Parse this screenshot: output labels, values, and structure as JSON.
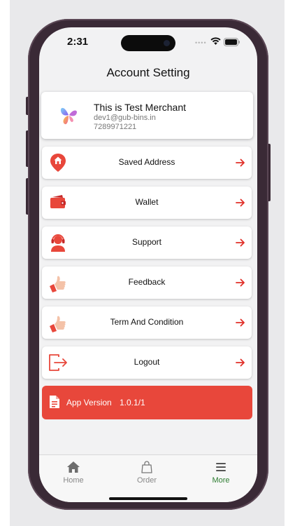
{
  "status_bar": {
    "time": "2:31"
  },
  "header": {
    "title": "Account Setting"
  },
  "profile": {
    "name": "This is Test Merchant",
    "email": "dev1@gub-bins.in",
    "phone": "7289971221"
  },
  "menu": [
    {
      "label": "Saved Address",
      "icon": "location-home-icon"
    },
    {
      "label": "Wallet",
      "icon": "wallet-icon"
    },
    {
      "label": "Support",
      "icon": "headset-icon"
    },
    {
      "label": "Feedback",
      "icon": "thumbs-up-icon"
    },
    {
      "label": "Term And Condition",
      "icon": "thumbs-up-icon"
    },
    {
      "label": "Logout",
      "icon": "logout-icon"
    }
  ],
  "app_version": {
    "label": "App Version",
    "value": "1.0.1/1"
  },
  "tabs": [
    {
      "label": "Home",
      "icon": "home-icon"
    },
    {
      "label": "Order",
      "icon": "bag-icon"
    },
    {
      "label": "More",
      "icon": "menu-icon"
    }
  ],
  "colors": {
    "accent": "#e8473b",
    "active_tab": "#2e7d32",
    "background": "#f2f2f3"
  }
}
